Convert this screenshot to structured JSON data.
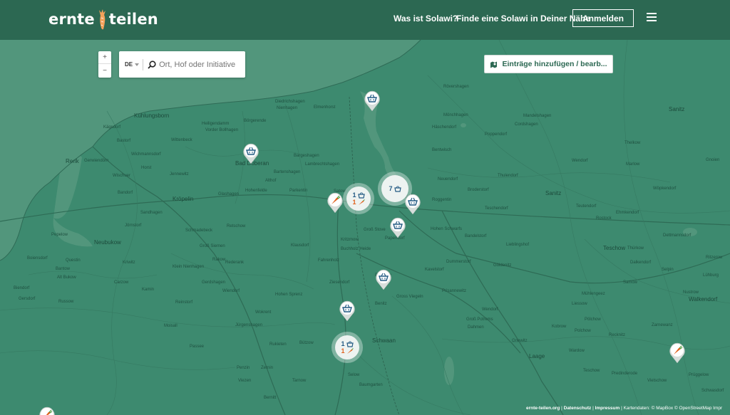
{
  "header": {
    "logo_left": "ernte",
    "logo_right": "teilen",
    "nav": [
      "Was ist Solawi?",
      "Finde eine Solawi in Deiner Nähe"
    ],
    "login": "Anmelden"
  },
  "controls": {
    "zoom_in": "+",
    "zoom_out": "−",
    "country": "DE",
    "search_placeholder": "Ort, Hof oder Initiative",
    "entries_button": "Einträge hinzufügen / bearb..."
  },
  "clusters": [
    {
      "count_top": "7",
      "count_bottom": ""
    },
    {
      "count_top": "1",
      "count_bottom": "1"
    },
    {
      "count_top": "1",
      "count_bottom": "1"
    }
  ],
  "places": [
    "Kühlungsborn",
    "Kägsdorf",
    "Bastorf",
    "Wichmannsdorf",
    "Rerik",
    "Gerwiendörn",
    "Wischuer",
    "Horst",
    "Jennewitz",
    "Kröpelin",
    "Bandorf",
    "Sandhagen",
    "Jörnstorf",
    "Pepelow",
    "Neubukow",
    "Schmadebeck",
    "Groß Siemen",
    "Retschow",
    "Boiensdorf",
    "Questin",
    "Bantow",
    "Alt Bukow",
    "Kriwitz",
    "Klein Nienhagen",
    "Rakow",
    "Rederank",
    "Carzow",
    "Gerdshagen",
    "Russow",
    "Kamin",
    "Reinstorf",
    "Biendorf",
    "Gersdorf",
    "Parkentin",
    "Bad Doberan",
    "Satow",
    "Glashagen",
    "Hohenfelde",
    "Bartenshagen",
    "Althof",
    "Wittenbeck",
    "Heiligendamm",
    "Vorder Bollhagen",
    "Börgerende",
    "Bargeshagen",
    "Lambrechtshagen",
    "Diedrichshagen",
    "Nienhagen",
    "Elmenhorst",
    "Rövershagen",
    "Mönchhagen",
    "Häschendorf",
    "Mandelshagen",
    "Cordshagen",
    "Poppendorf",
    "Bentwisch",
    "Neuendorf",
    "Roggentin",
    "Broderstorf",
    "Teschendorf",
    "Thulendorf",
    "Sanitz",
    "Wendorf",
    "Teutendorf",
    "Kritzmow",
    "Groß Stove",
    "Papendorf",
    "Hohen Schwarfs",
    "Bandelstorf",
    "Lieblingshof",
    "Dummerstorf",
    "Kavelstorf",
    "Buchholz Heide",
    "Fahrenholz",
    "Klausdorf",
    "Ziesendorf",
    "Polchow",
    "Hohen Sprenz",
    "Gross Viegeln",
    "Benitz",
    "Schwaan",
    "Prisannewitz",
    "Wendorf",
    "Groß Potrems",
    "Göldenitz",
    "Dahmen",
    "Gnewitz",
    "Laage",
    "Bützow",
    "Wardow",
    "Mühlengeez",
    "Pölchow",
    "Recknitz",
    "Teschow",
    "Kobrow",
    "Polchow",
    "Liessow",
    "Predinderode",
    "Vietschow",
    "Prüggelow",
    "Schwasdorf",
    "Wiendorf",
    "Wokrent",
    "Jürgenshagen",
    "Rukieten",
    "Zernin",
    "Penzin",
    "Viezen",
    "Bernitt",
    "Tarnow",
    "Selow",
    "Baumgarten",
    "Moisall",
    "Passee",
    "Teschow",
    "Tessin",
    "Rostock",
    "Sanitz",
    "Marlow",
    "Dettmannsdorf",
    "Thelkow",
    "Wöpkendorf",
    "Ehmkendorf",
    "Zarnewanz",
    "Walkendorf",
    "Gnoien",
    "Ritzerow",
    "Nustrow",
    "Lühburg",
    "Samow",
    "Selpin",
    "Thürkow",
    "Dalkendorf",
    "Prebberede"
  ],
  "footer": {
    "site": "ernte-teilen.org",
    "privacy": "Datenschutz",
    "imprint": "Impressum",
    "credits": "Kartendaten: © MapBox © OpenStreetMap Impr"
  }
}
